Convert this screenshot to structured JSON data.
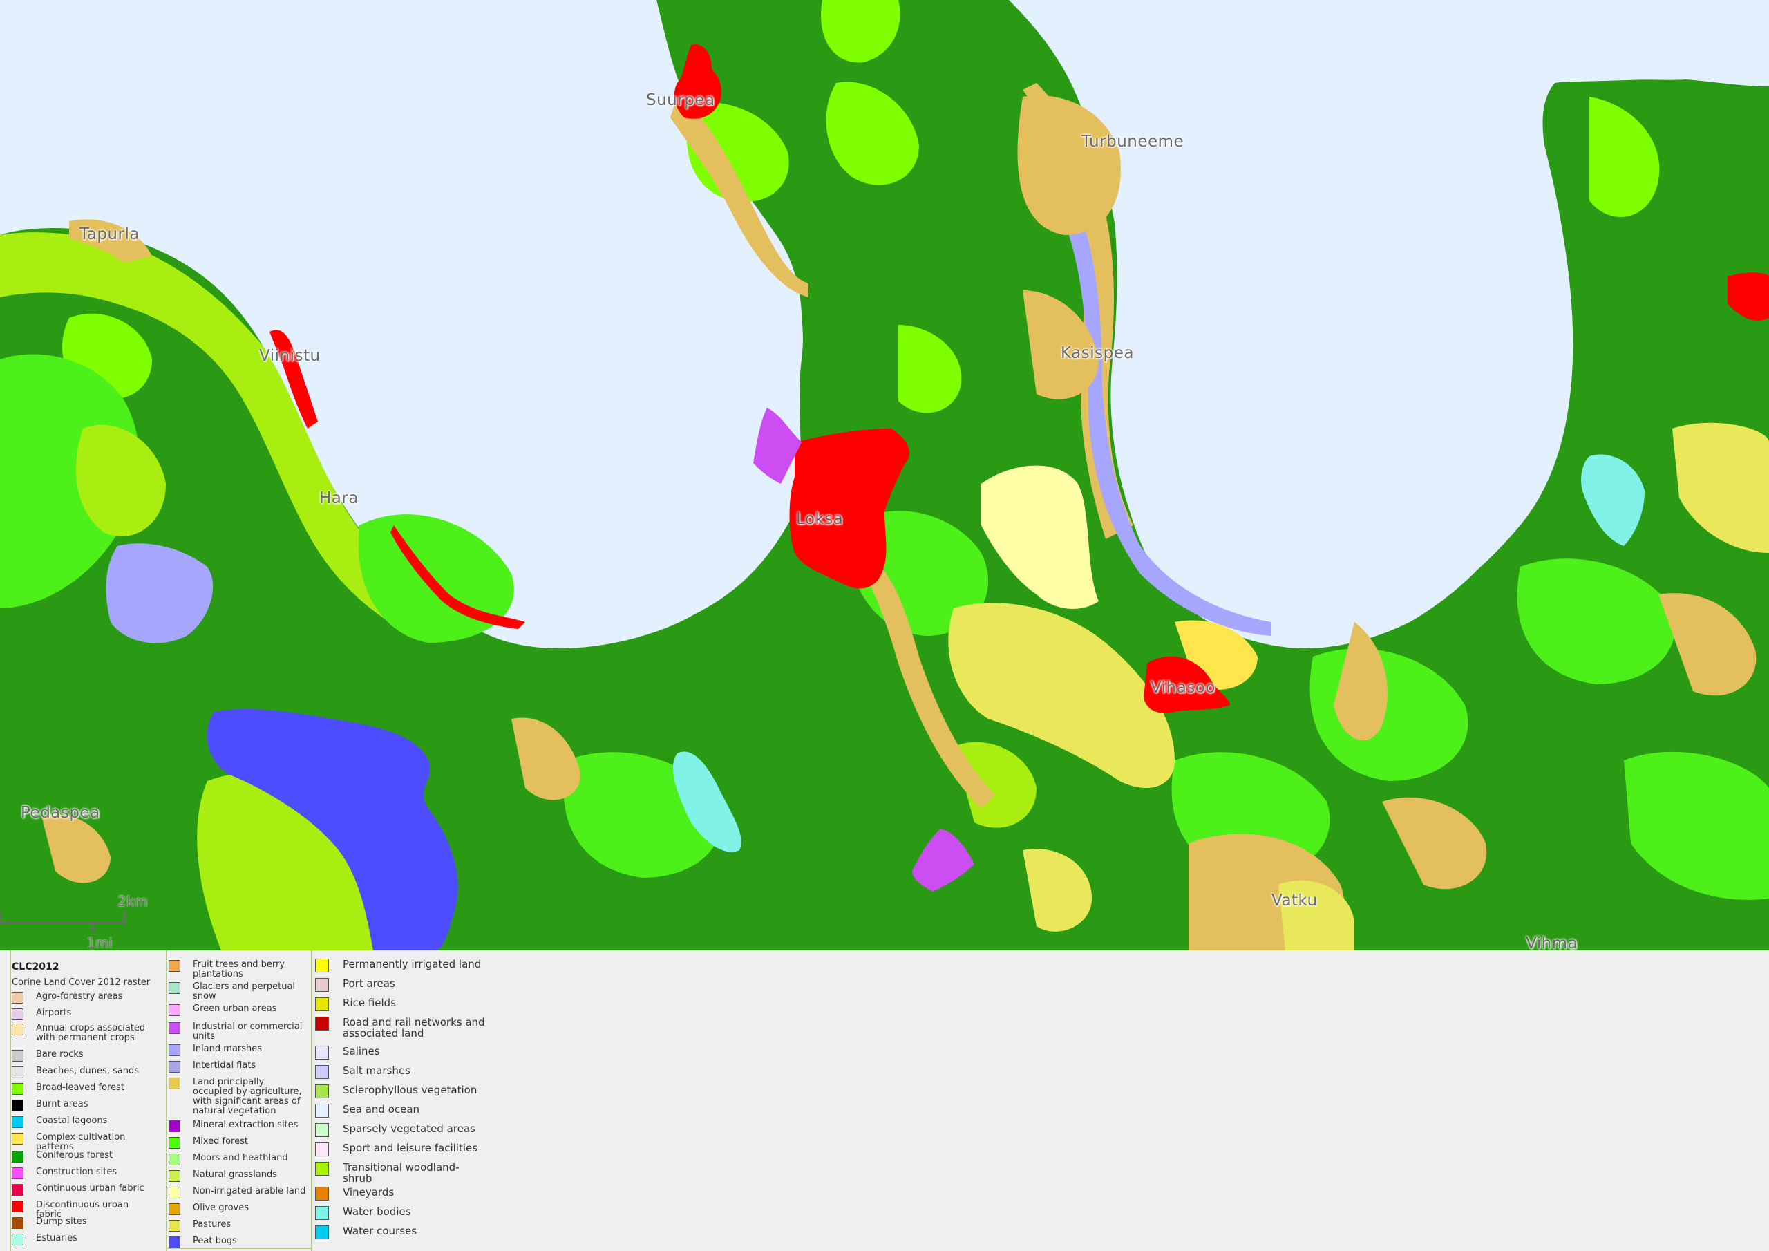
{
  "map": {
    "places": [
      {
        "name": "Suurpea"
      },
      {
        "name": "Turbuneeme"
      },
      {
        "name": "Tapurla"
      },
      {
        "name": "Viinistu"
      },
      {
        "name": "Kasispea"
      },
      {
        "name": "Hara"
      },
      {
        "name": "Loksa"
      },
      {
        "name": "Vihasoo"
      },
      {
        "name": "Pedaspea"
      },
      {
        "name": "Vatku"
      },
      {
        "name": "Vihma"
      }
    ],
    "scale": {
      "top_label": "2km",
      "bottom_label": "1mi"
    },
    "colors": {
      "sea": "#e3f0fd",
      "coniferous_forest": "#2a9a14",
      "broad_leaved_forest": "#80ff00",
      "mixed_forest": "#4ef01a",
      "transitional_woodland_shrub": "#a8ee10",
      "land_with_natural_vegetation": "#e4bf5e",
      "pastures": "#e8e85a",
      "non_irrigated_arable": "#ffffa8",
      "discontinuous_urban": "#ff0000",
      "industrial": "#cc4df2",
      "inland_marshes": "#a6a6ff",
      "peat_bogs": "#4d4dff",
      "water_bodies": "#80f2e6",
      "complex_cultivation": "#ffe64d"
    }
  },
  "legend": {
    "title": "CLC2012",
    "subtitle": "Corine Land Cover 2012 raster",
    "column1": [
      {
        "label": "Agro-forestry areas",
        "color": "#f2cca6"
      },
      {
        "label": "Airports",
        "color": "#e6cce6"
      },
      {
        "label": "Annual crops associated with permanent crops",
        "color": "#ffe6a6"
      },
      {
        "label": "Bare rocks",
        "color": "#cccccc"
      },
      {
        "label": "Beaches, dunes, sands",
        "color": "#e6e6e6"
      },
      {
        "label": "Broad-leaved forest",
        "color": "#80ff00"
      },
      {
        "label": "Burnt areas",
        "color": "#000000"
      },
      {
        "label": "Coastal lagoons",
        "color": "#00ccf2"
      },
      {
        "label": "Complex cultivation patterns",
        "color": "#ffe64d"
      },
      {
        "label": "Coniferous forest",
        "color": "#00a600"
      },
      {
        "label": "Construction sites",
        "color": "#ff4dff"
      },
      {
        "label": "Continuous urban fabric",
        "color": "#e6004d"
      },
      {
        "label": "Discontinuous urban fabric",
        "color": "#ff0000"
      },
      {
        "label": "Dump sites",
        "color": "#a64d00"
      },
      {
        "label": "Estuaries",
        "color": "#a6ffe6"
      }
    ],
    "column2": [
      {
        "label": "Fruit trees and berry plantations",
        "color": "#f2a64d"
      },
      {
        "label": "Glaciers and perpetual snow",
        "color": "#a6e6cc"
      },
      {
        "label": "Green urban areas",
        "color": "#ffa6ff"
      },
      {
        "label": "Industrial or commercial units",
        "color": "#cc4df2"
      },
      {
        "label": "Inland marshes",
        "color": "#a6a6ff"
      },
      {
        "label": "Intertidal flats",
        "color": "#a6a6e6"
      },
      {
        "label": "Land principally occupied by agriculture, with significant areas of natural vegetation",
        "color": "#e6cc4d"
      },
      {
        "label": "Mineral extraction sites",
        "color": "#a600cc"
      },
      {
        "label": "Mixed forest",
        "color": "#4dff00"
      },
      {
        "label": "Moors and heathland",
        "color": "#a6ff80"
      },
      {
        "label": "Natural grasslands",
        "color": "#ccf24d"
      },
      {
        "label": "Non-irrigated arable land",
        "color": "#ffffa8"
      },
      {
        "label": "Olive groves",
        "color": "#e6a600"
      },
      {
        "label": "Pastures",
        "color": "#e6e64d"
      },
      {
        "label": "Peat bogs",
        "color": "#4d4dff"
      }
    ],
    "column3": [
      {
        "label": "Permanently irrigated land",
        "color": "#ffff00"
      },
      {
        "label": "Port areas",
        "color": "#e6cccc"
      },
      {
        "label": "Rice fields",
        "color": "#e6e600"
      },
      {
        "label": "Road and rail networks and associated land",
        "color": "#cc0000"
      },
      {
        "label": "Salines",
        "color": "#e6e6ff"
      },
      {
        "label": "Salt marshes",
        "color": "#ccccff"
      },
      {
        "label": "Sclerophyllous vegetation",
        "color": "#a6e64d"
      },
      {
        "label": "Sea and ocean",
        "color": "#e6f2ff"
      },
      {
        "label": "Sparsely vegetated areas",
        "color": "#ccffcc"
      },
      {
        "label": "Sport and leisure facilities",
        "color": "#ffe6ff"
      },
      {
        "label": "Transitional woodland-shrub",
        "color": "#a6f200"
      },
      {
        "label": "Vineyards",
        "color": "#e68000"
      },
      {
        "label": "Water bodies",
        "color": "#80f2e6"
      },
      {
        "label": "Water courses",
        "color": "#00ccf2"
      }
    ]
  }
}
